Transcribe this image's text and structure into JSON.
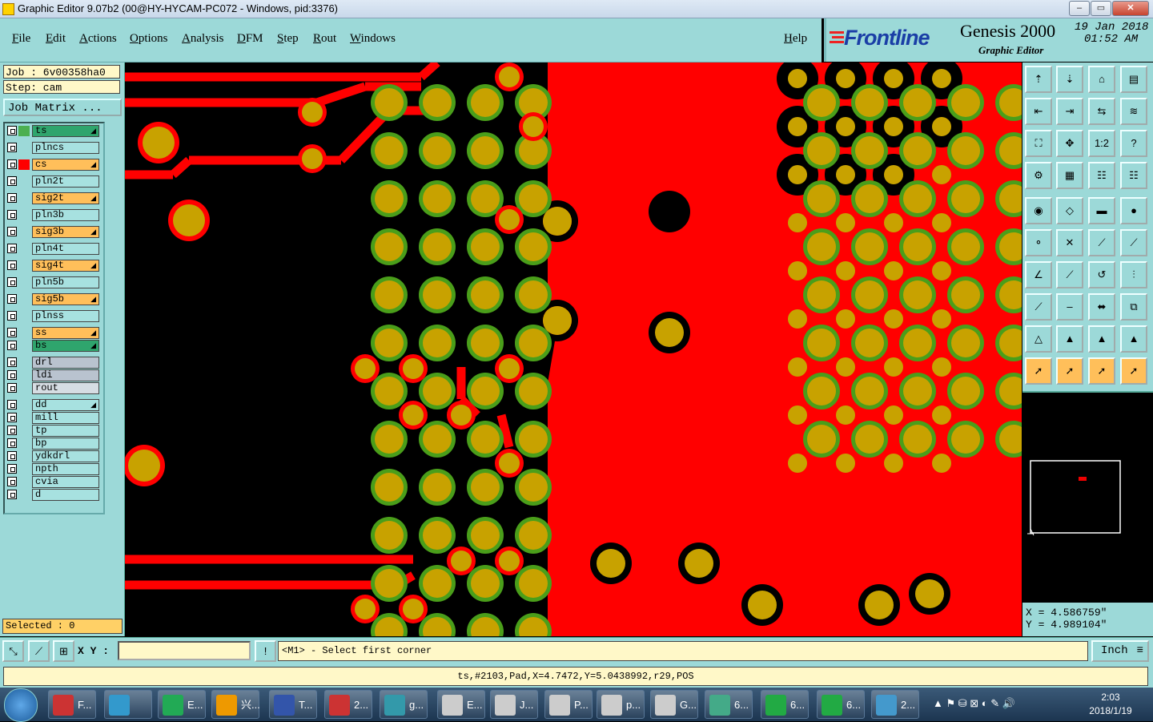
{
  "window": {
    "title": "Graphic Editor 9.07b2 (00@HY-HYCAM-PC072 - Windows, pid:3376)",
    "controls": [
      "–",
      "▭",
      "✕"
    ]
  },
  "menu": {
    "items": [
      "File",
      "Edit",
      "Actions",
      "Options",
      "Analysis",
      "DFM",
      "Step",
      "Rout",
      "Windows"
    ],
    "help": "Help"
  },
  "branding": {
    "logo": "Frontline",
    "product": "Genesis 2000",
    "subtitle": "Graphic Editor",
    "date": "19 Jan 2018",
    "time": "01:52 AM"
  },
  "job": {
    "job_line": "Job : 6v00358ha0",
    "step_line": "Step: cam",
    "matrix_button": "Job Matrix ..."
  },
  "layers": [
    {
      "name": "ts",
      "color": "#2fa56d",
      "swatch": "#4caf50",
      "arrow": true
    },
    {
      "name": "plncs",
      "color": "#a7e1e0",
      "swatch": "",
      "arrow": false
    },
    {
      "name": "cs",
      "color": "#ffbf5a",
      "swatch": "#ff0000",
      "arrow": true
    },
    {
      "name": "pln2t",
      "color": "#a7e1e0",
      "swatch": "",
      "arrow": false
    },
    {
      "name": "sig2t",
      "color": "#ffbf5a",
      "swatch": "",
      "arrow": true
    },
    {
      "name": "pln3b",
      "color": "#a7e1e0",
      "swatch": "",
      "arrow": false
    },
    {
      "name": "sig3b",
      "color": "#ffbf5a",
      "swatch": "",
      "arrow": true
    },
    {
      "name": "pln4t",
      "color": "#a7e1e0",
      "swatch": "",
      "arrow": false
    },
    {
      "name": "sig4t",
      "color": "#ffbf5a",
      "swatch": "",
      "arrow": true
    },
    {
      "name": "pln5b",
      "color": "#a7e1e0",
      "swatch": "",
      "arrow": false
    },
    {
      "name": "sig5b",
      "color": "#ffbf5a",
      "swatch": "",
      "arrow": true
    },
    {
      "name": "plnss",
      "color": "#a7e1e0",
      "swatch": "",
      "arrow": false
    },
    {
      "name": "ss",
      "color": "#ffbf5a",
      "swatch": "",
      "arrow": true
    },
    {
      "name": "bs",
      "color": "#2fa56d",
      "swatch": "",
      "arrow": true
    },
    {
      "name": "drl",
      "color": "#b9c3cf",
      "swatch": "",
      "arrow": false
    },
    {
      "name": "ldi",
      "color": "#b9c3cf",
      "swatch": "",
      "arrow": false
    },
    {
      "name": "rout",
      "color": "#d6dde3",
      "swatch": "",
      "arrow": false
    },
    {
      "name": "dd",
      "color": "#a7e1e0",
      "swatch": "",
      "arrow": true
    },
    {
      "name": "mill",
      "color": "#a7e1e0",
      "swatch": "",
      "arrow": false
    },
    {
      "name": "tp",
      "color": "#a7e1e0",
      "swatch": "",
      "arrow": false
    },
    {
      "name": "bp",
      "color": "#a7e1e0",
      "swatch": "",
      "arrow": false
    },
    {
      "name": "ydkdrl",
      "color": "#a7e1e0",
      "swatch": "",
      "arrow": false
    },
    {
      "name": "npth",
      "color": "#a7e1e0",
      "swatch": "",
      "arrow": false
    },
    {
      "name": "cvia",
      "color": "#a7e1e0",
      "swatch": "",
      "arrow": false
    },
    {
      "name": "d",
      "color": "#a7e1e0",
      "swatch": "",
      "arrow": false
    }
  ],
  "selected": "Selected : 0",
  "coords": {
    "x": "X = 4.586759\"",
    "y": "Y = 4.989104\""
  },
  "toolbar_glyphs": [
    "⇡",
    "⇣",
    "⌂",
    "▤",
    "⇤",
    "⇥",
    "⇆",
    "≋",
    "⛶",
    "✥",
    "1:2",
    "?",
    "⚙",
    "▦",
    "☷",
    "☷",
    "◉",
    "◇",
    "▬",
    "●",
    "⚬",
    "✕",
    "⟋",
    "⟋",
    "∠",
    "⟋",
    "↺",
    "⫶",
    "⟋",
    "–",
    "⬌",
    "⧉",
    "△",
    "▲",
    "▲",
    "▲",
    "➚",
    "➚",
    "➚",
    "➚"
  ],
  "command": {
    "xy_label": "X Y :",
    "xy_value": "",
    "prompt": "<M1> - Select first corner",
    "units": "Inch"
  },
  "status_line": "ts,#2103,Pad,X=4.7472,Y=5.0438992,r29,POS",
  "taskbar": {
    "items": [
      "F...",
      "",
      "E...",
      "兴...",
      "T...",
      "2...",
      "g...",
      "E...",
      "J...",
      "P...",
      "p...",
      "G...",
      "6...",
      "6...",
      "6...",
      "2..."
    ],
    "clock_time": "2:03",
    "clock_date": "2018/1/19"
  }
}
